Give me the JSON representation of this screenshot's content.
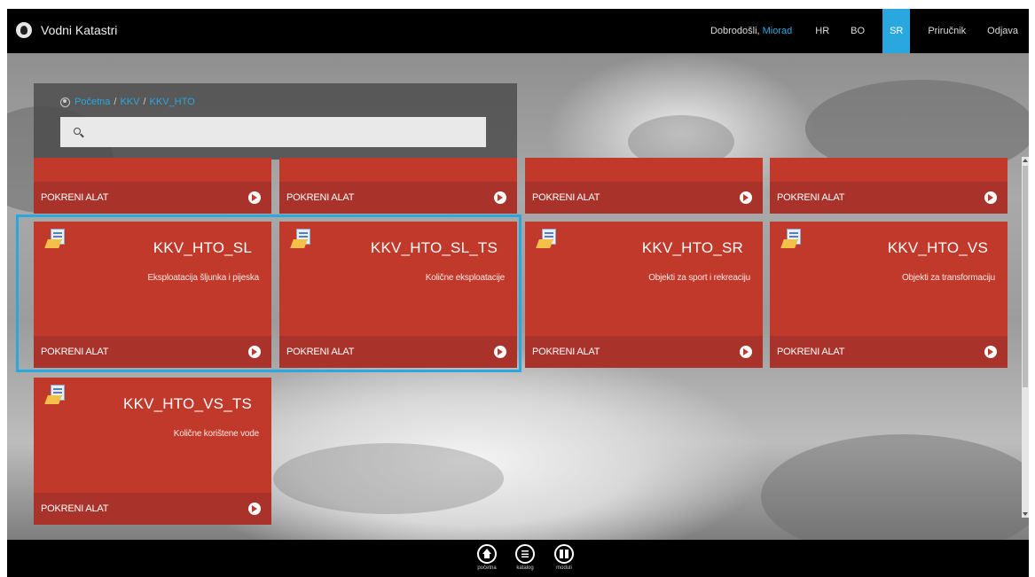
{
  "header": {
    "app_title": "Vodni Katastri",
    "welcome_prefix": "Dobrodošli,",
    "user_name": "Miorad",
    "languages": [
      "HR",
      "BO",
      "SR"
    ],
    "active_language": "SR",
    "manual_label": "Priručnik",
    "logout_label": "Odjava"
  },
  "breadcrumb": [
    "Početna",
    "KKV",
    "KKV_HTO"
  ],
  "search": {
    "placeholder": "",
    "value": ""
  },
  "tiles_top_row": [
    {
      "footer": "POKRENI ALAT"
    },
    {
      "footer": "POKRENI ALAT"
    },
    {
      "footer": "POKRENI ALAT"
    },
    {
      "footer": "POKRENI ALAT"
    }
  ],
  "tiles": [
    {
      "title": "KKV_HTO_SL",
      "subtitle": "Eksploatacija šljunka i pijeska",
      "footer": "POKRENI ALAT"
    },
    {
      "title": "KKV_HTO_SL_TS",
      "subtitle": "Količne eksploatacije",
      "footer": "POKRENI ALAT"
    },
    {
      "title": "KKV_HTO_SR",
      "subtitle": "Objekti za sport i rekreaciju",
      "footer": "POKRENI ALAT"
    },
    {
      "title": "KKV_HTO_VS",
      "subtitle": "Objekti za transformaciju",
      "footer": "POKRENI ALAT"
    },
    {
      "title": "KKV_HTO_VS_TS",
      "subtitle": "Količne korištene vode",
      "footer": "POKRENI ALAT"
    }
  ],
  "bottom_nav": [
    {
      "icon": "home-icon",
      "label": "početna"
    },
    {
      "icon": "list-icon",
      "label": "katalog"
    },
    {
      "icon": "grid-icon",
      "label": "moduli"
    }
  ],
  "colors": {
    "accent": "#29a8e0",
    "tile": "#c0392b",
    "tile_footer": "#a9322a",
    "bar": "#000000"
  }
}
